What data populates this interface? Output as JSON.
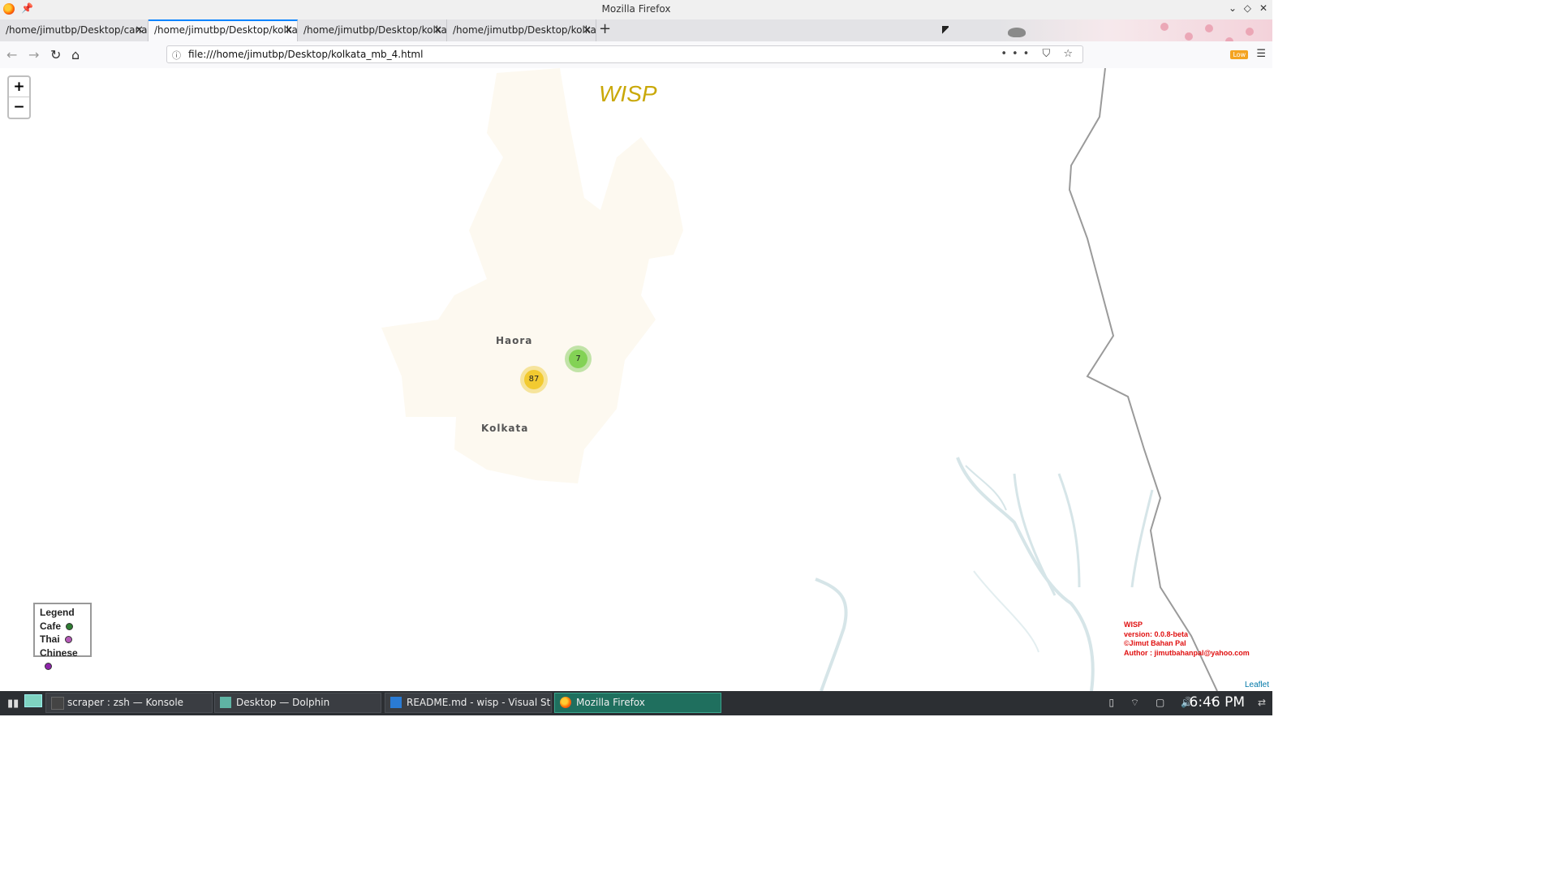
{
  "window": {
    "title": "Mozilla Firefox"
  },
  "tabs": [
    {
      "label": "/home/jimutbp/Desktop/canada",
      "active": false
    },
    {
      "label": "/home/jimutbp/Desktop/kolkata",
      "active": true
    },
    {
      "label": "/home/jimutbp/Desktop/kolkata",
      "active": false
    },
    {
      "label": "/home/jimutbp/Desktop/kolkata",
      "active": false
    }
  ],
  "toolbar": {
    "url": "file:///home/jimutbp/Desktop/kolkata_mb_4.html",
    "low_badge": "Low",
    "page_actions": "••• ⛉ ☆"
  },
  "map": {
    "title": "WISP",
    "zoom_in": "+",
    "zoom_out": "−",
    "places": [
      {
        "name": "Haora"
      },
      {
        "name": "Kolkata"
      }
    ],
    "clusters": [
      {
        "count": "87",
        "color": "#f1d357"
      },
      {
        "count": "7",
        "color": "#8fd16b"
      }
    ],
    "legend": {
      "title": "Legend",
      "items": [
        {
          "label": "Cafe",
          "color": "#2e7d32"
        },
        {
          "label": "Thai",
          "color": "#b65ab8"
        },
        {
          "label": "Chinese",
          "color": "#8e24aa"
        }
      ]
    },
    "credit": {
      "line1": "WISP",
      "line2": "version: 0.0.8-beta",
      "line3": "©Jimut Bahan Pal",
      "line4": "Author : jimutbahanpal@yahoo.com"
    },
    "attribution": "Leaflet"
  },
  "taskbar": {
    "tasks": [
      {
        "label": "scraper : zsh — Konsole",
        "active": false
      },
      {
        "label": "Desktop — Dolphin",
        "active": false
      },
      {
        "label": "README.md - wisp - Visual Studio ...",
        "active": false
      },
      {
        "label": "Mozilla Firefox",
        "active": true
      }
    ],
    "clock": "6:46 PM"
  }
}
